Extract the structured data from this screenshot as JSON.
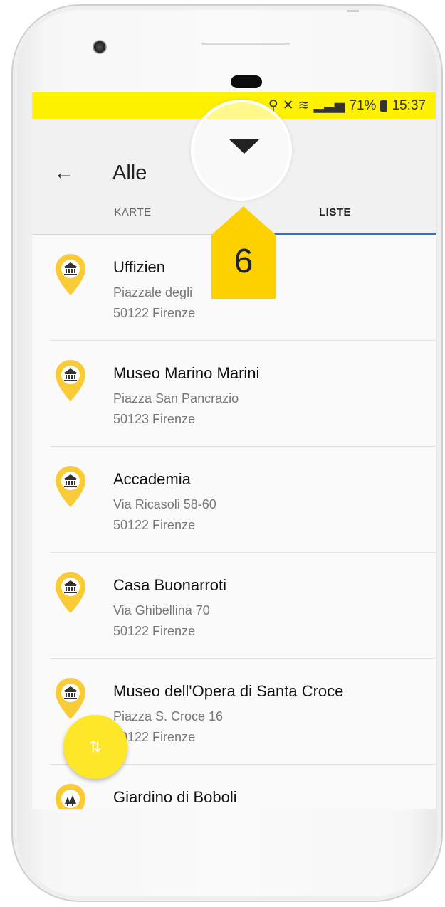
{
  "status_bar": {
    "battery_percent": "71%",
    "time": "15:37"
  },
  "app_bar": {
    "back_icon": "arrow-left-icon",
    "title": "Alle",
    "tabs": [
      {
        "label": "KARTE",
        "active": false
      },
      {
        "label": "LISTE",
        "active": true
      }
    ]
  },
  "places": [
    {
      "name": "Uffizien",
      "address_line1": "Piazzale degli",
      "address_line2": "50122 Firenze",
      "icon": "museum-icon"
    },
    {
      "name": "Museo Marino Marini",
      "address_line1": "Piazza San Pancrazio",
      "address_line2": "50123 Firenze",
      "icon": "museum-icon"
    },
    {
      "name": "Accademia",
      "address_line1": "Via Ricasoli 58-60",
      "address_line2": "50122 Firenze",
      "icon": "museum-icon"
    },
    {
      "name": "Casa Buonarroti",
      "address_line1": "Via Ghibellina 70",
      "address_line2": "50122 Firenze",
      "icon": "museum-icon"
    },
    {
      "name": "Museo dell'Opera di Santa Croce",
      "address_line1": "Piazza S. Croce 16",
      "address_line2": "50122 Firenze",
      "icon": "museum-icon"
    },
    {
      "name": "Giardino di Boboli",
      "address_line1": "",
      "address_line2": "",
      "icon": "park-icon"
    }
  ],
  "fab": {
    "icon": "sort-arrows-icon"
  },
  "annotation": {
    "number": "6"
  },
  "colors": {
    "accent_yellow": "#fde728",
    "status_bar_yellow": "#fff200",
    "tab_indicator_blue": "#2f74c0",
    "pin_yellow": "#f9cc37"
  }
}
